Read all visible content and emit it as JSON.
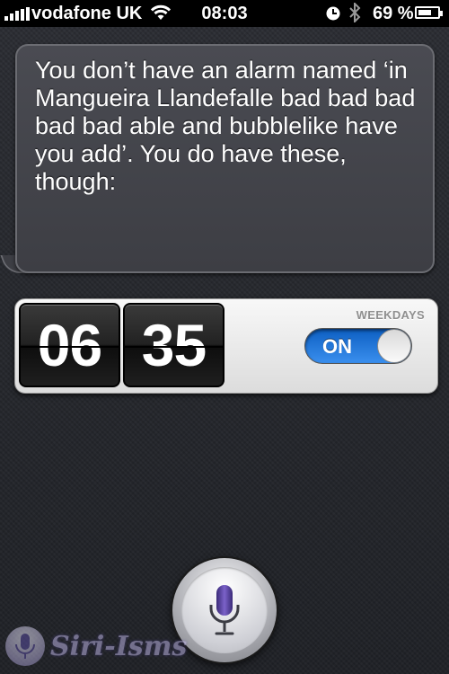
{
  "status_bar": {
    "carrier": "vodafone UK",
    "time": "08:03",
    "battery_percent": "69 %",
    "battery_level": 0.69,
    "signal_icon": "signal-bars-icon",
    "wifi_icon": "wifi-icon",
    "clock_icon": "alarm-clock-icon",
    "bluetooth_icon": "bluetooth-icon"
  },
  "siri_response": {
    "text": "You don’t have an alarm named ‘in Mangueira Llandefalle bad bad bad bad bad able and bubblelike have you add’.  You do have these, though:"
  },
  "alarm": {
    "hours": "06",
    "minutes": "35",
    "repeat": "WEEKDAYS",
    "toggle_label": "ON",
    "enabled": true,
    "accent_color": "#1f78e0"
  },
  "mic": {
    "icon": "microphone-icon",
    "accent_color": "#6a4fb5"
  },
  "watermark": {
    "text": "Siri-Isms"
  }
}
